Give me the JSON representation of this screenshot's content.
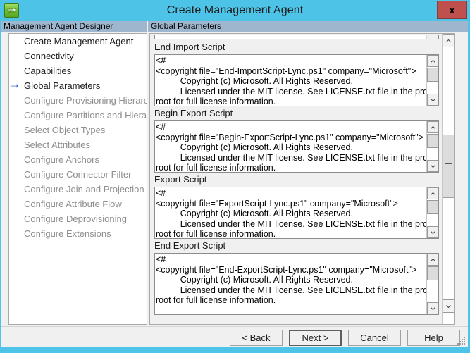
{
  "window": {
    "title": "Create Management Agent",
    "app_icon": "sync-arrows-icon",
    "close_label": "x"
  },
  "left_pane": {
    "header": "Management Agent Designer",
    "items": [
      {
        "label": "Create Management Agent",
        "state": "enabled",
        "current": false
      },
      {
        "label": "Connectivity",
        "state": "enabled",
        "current": false
      },
      {
        "label": "Capabilities",
        "state": "enabled",
        "current": false
      },
      {
        "label": "Global Parameters",
        "state": "enabled",
        "current": true,
        "marker": "⇒"
      },
      {
        "label": "Configure Provisioning Hierarchy",
        "state": "disabled",
        "current": false
      },
      {
        "label": "Configure Partitions and Hierarchies",
        "state": "disabled",
        "current": false
      },
      {
        "label": "Select Object Types",
        "state": "disabled",
        "current": false
      },
      {
        "label": "Select Attributes",
        "state": "disabled",
        "current": false
      },
      {
        "label": "Configure Anchors",
        "state": "disabled",
        "current": false
      },
      {
        "label": "Configure Connector Filter",
        "state": "disabled",
        "current": false
      },
      {
        "label": "Configure Join and Projection Rules",
        "state": "disabled",
        "current": false
      },
      {
        "label": "Configure Attribute Flow",
        "state": "disabled",
        "current": false
      },
      {
        "label": "Configure Deprovisioning",
        "state": "disabled",
        "current": false
      },
      {
        "label": "Configure Extensions",
        "state": "disabled",
        "current": false
      }
    ]
  },
  "right_pane": {
    "header": "Global Parameters",
    "fields": [
      {
        "label": "End Import Script",
        "value": "<#\n<copyright file=\"End-ImportScript-Lync.ps1\" company=\"Microsoft\">\n          Copyright (c) Microsoft. All Rights Reserved.\n          Licensed under the MIT license. See LICENSE.txt file in the project\nroot for full license information."
      },
      {
        "label": "Begin Export Script",
        "value": "<#\n<copyright file=\"Begin-ExportScript-Lync.ps1\" company=\"Microsoft\">\n          Copyright (c) Microsoft. All Rights Reserved.\n          Licensed under the MIT license. See LICENSE.txt file in the project\nroot for full license information."
      },
      {
        "label": "Export Script",
        "value": "<#\n<copyright file=\"ExportScript-Lync.ps1\" company=\"Microsoft\">\n          Copyright (c) Microsoft. All Rights Reserved.\n          Licensed under the MIT license. See LICENSE.txt file in the project\nroot for full license information."
      },
      {
        "label": "End Export Script",
        "value": "<#\n<copyright file=\"End-ExportScript-Lync.ps1\" company=\"Microsoft\">\n          Copyright (c) Microsoft. All Rights Reserved.\n          Licensed under the MIT license. See LICENSE.txt file in the project\nroot for full license information."
      }
    ]
  },
  "buttons": {
    "back": "< Back",
    "next": "Next >",
    "cancel": "Cancel",
    "help": "Help"
  },
  "colors": {
    "titlebar": "#4ec3e8",
    "header_band": "#9fb6cf",
    "close_button": "#c0504d",
    "dialog_face": "#f0f0f0",
    "current_marker": "#1f4fd8",
    "disabled_text": "#8e8e8e"
  }
}
